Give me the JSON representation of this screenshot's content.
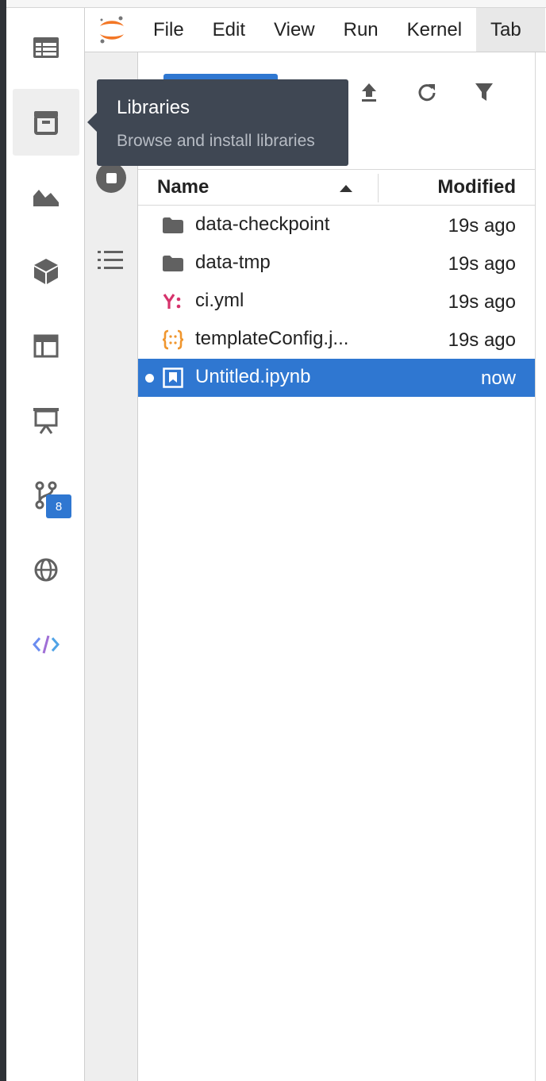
{
  "menubar": {
    "items": [
      "File",
      "Edit",
      "View",
      "Run",
      "Kernel",
      "Tab"
    ]
  },
  "activity_bar": {
    "icons": [
      "table-icon",
      "library-icon",
      "area-chart-icon",
      "cube-icon",
      "layout-icon",
      "presentation-icon",
      "git-branch-icon",
      "globe-icon",
      "code-icon"
    ],
    "git_badge": "8"
  },
  "tooltip": {
    "title": "Libraries",
    "subtitle": "Browse and install libraries"
  },
  "file_browser": {
    "columns": {
      "name": "Name",
      "modified": "Modified"
    },
    "rows": [
      {
        "name": "data-checkpoint",
        "modified": "19s ago",
        "icon": "folder-icon"
      },
      {
        "name": "data-tmp",
        "modified": "19s ago",
        "icon": "folder-icon"
      },
      {
        "name": "ci.yml",
        "modified": "19s ago",
        "icon": "yaml-icon"
      },
      {
        "name": "templateConfig.j...",
        "modified": "19s ago",
        "icon": "json-icon"
      },
      {
        "name": "Untitled.ipynb",
        "modified": "now",
        "icon": "notebook-icon",
        "selected": true
      }
    ]
  },
  "colors": {
    "accent": "#2f77d1",
    "tooltip_bg": "#3f4753",
    "jupyter_orange": "#f37726",
    "yaml_pink": "#d6336c",
    "json_orange": "#f0962e"
  }
}
